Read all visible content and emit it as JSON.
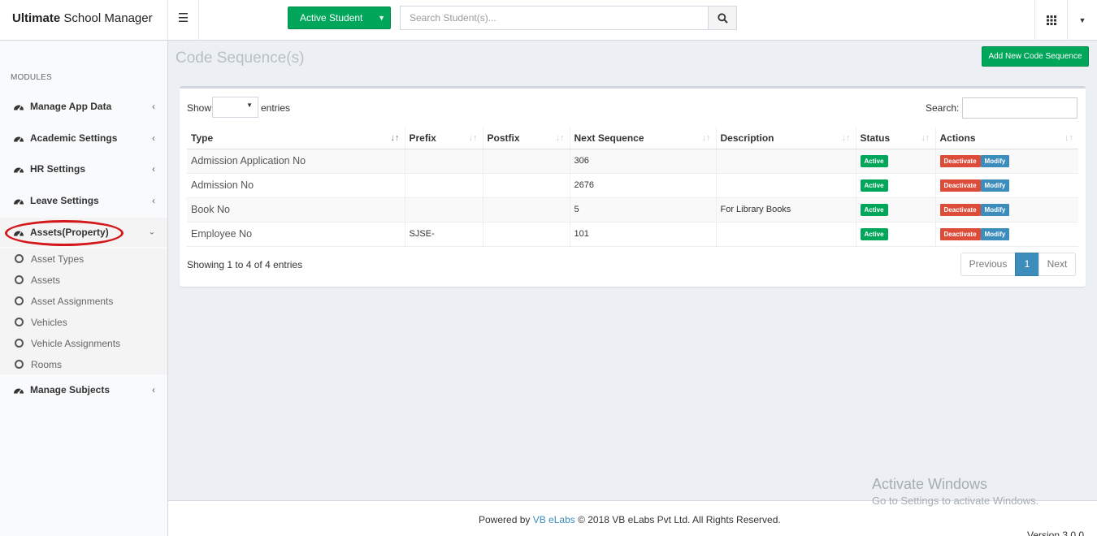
{
  "header": {
    "app_title_bold": "Ultimate",
    "app_title_rest": " School Manager",
    "student_dropdown": "Active Student",
    "search_placeholder": "Search Student(s)..."
  },
  "sidebar": {
    "section_label": "MODULES",
    "items": [
      {
        "label": "Manage App Data"
      },
      {
        "label": "Academic Settings"
      },
      {
        "label": "HR Settings"
      },
      {
        "label": "Leave Settings"
      },
      {
        "label": "Assets(Property)"
      },
      {
        "label": "Manage Subjects"
      }
    ],
    "subitems": [
      {
        "label": "Asset Types"
      },
      {
        "label": "Assets"
      },
      {
        "label": "Asset Assignments"
      },
      {
        "label": "Vehicles"
      },
      {
        "label": "Vehicle Assignments"
      },
      {
        "label": "Rooms"
      }
    ]
  },
  "page": {
    "title": "Code Sequence(s)",
    "add_button": "Add New Code Sequence"
  },
  "table": {
    "show_label": "Show",
    "entries_label": "entries",
    "search_label": "Search:",
    "columns": [
      "Type",
      "Prefix",
      "Postfix",
      "Next Sequence",
      "Description",
      "Status",
      "Actions"
    ],
    "rows": [
      {
        "type": "Admission Application No",
        "prefix": "",
        "postfix": "",
        "next": "306",
        "description": "",
        "status": "Active"
      },
      {
        "type": "Admission No",
        "prefix": "",
        "postfix": "",
        "next": "2676",
        "description": "",
        "status": "Active"
      },
      {
        "type": "Book No",
        "prefix": "",
        "postfix": "",
        "next": "5",
        "description": "For Library Books",
        "status": "Active"
      },
      {
        "type": "Employee No",
        "prefix": "SJSE-",
        "postfix": "",
        "next": "101",
        "description": "",
        "status": "Active"
      }
    ],
    "action_deactivate": "Deactivate",
    "action_modify": "Modify",
    "info": "Showing 1 to 4 of 4 entries",
    "pager": {
      "previous": "Previous",
      "current": "1",
      "next": "Next"
    }
  },
  "footer": {
    "powered_by": "Powered by ",
    "link": "VB eLabs",
    "copyright": " © 2018 VB eLabs Pvt Ltd. All Rights Reserved.",
    "version": "Version 3.0.0"
  },
  "watermark": {
    "line1": "Activate Windows",
    "line2": "Go to Settings to activate Windows."
  },
  "colors": {
    "green": "#00a65a",
    "red": "#dd4b39",
    "blue": "#3c8dbc",
    "highlight_ellipse": "#d4181a"
  }
}
